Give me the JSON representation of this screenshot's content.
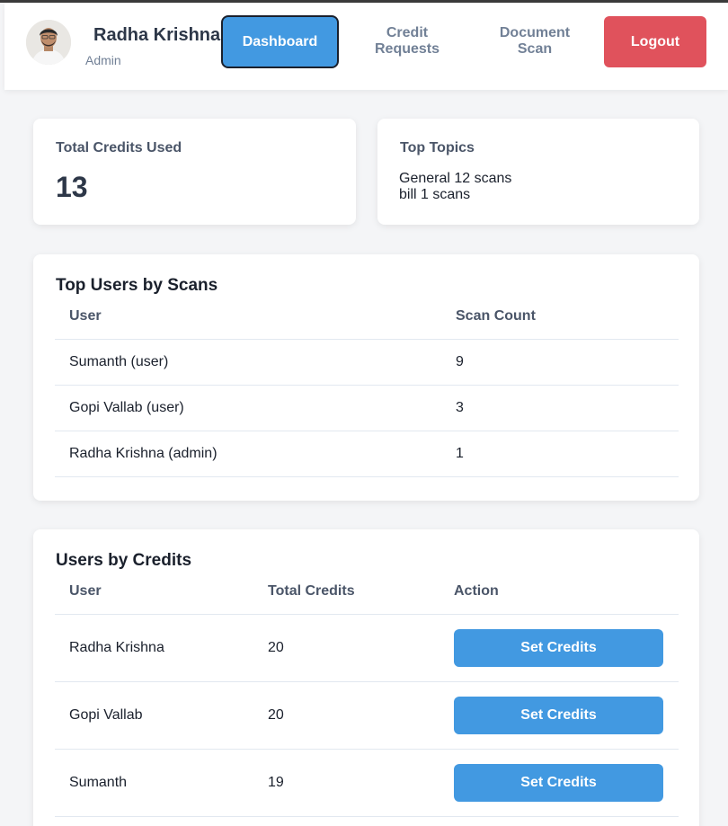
{
  "header": {
    "user_name": "Radha Krishna",
    "user_role": "Admin",
    "nav": {
      "dashboard": "Dashboard",
      "credit_requests_line1": "Credit",
      "credit_requests_line2": "Requests",
      "document_scan_line1": "Document",
      "document_scan_line2": "Scan"
    },
    "logout": "Logout"
  },
  "stats": {
    "total_credits_label": "Total Credits Used",
    "total_credits_value": "13",
    "top_topics_label": "Top Topics",
    "topics": [
      "General 12 scans",
      "bill 1 scans"
    ]
  },
  "top_users": {
    "title": "Top Users by Scans",
    "columns": [
      "User",
      "Scan Count"
    ],
    "rows": [
      [
        "Sumanth (user)",
        "9"
      ],
      [
        "Gopi Vallab (user)",
        "3"
      ],
      [
        "Radha Krishna (admin)",
        "1"
      ]
    ]
  },
  "users_by_credits": {
    "title": "Users by Credits",
    "columns": [
      "User",
      "Total Credits",
      "Action"
    ],
    "rows": [
      [
        "Radha Krishna",
        "20",
        "Set Credits"
      ],
      [
        "Gopi Vallab",
        "20",
        "Set Credits"
      ],
      [
        "Sumanth",
        "19",
        "Set Credits"
      ]
    ]
  },
  "colors": {
    "primary": "#4299e1",
    "danger": "#e0525c",
    "background": "#f4f5f7"
  }
}
